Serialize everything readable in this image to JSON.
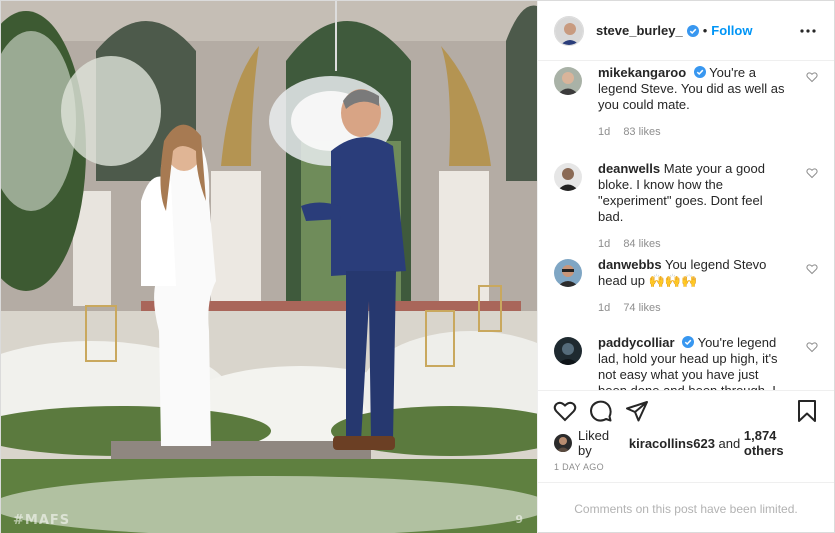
{
  "header": {
    "username": "steve_burley_",
    "dot": "•",
    "follow_label": "Follow"
  },
  "comments": [
    {
      "username": "mikekangaroo",
      "text": "You're a legend Steve. You did as well as you could mate.",
      "time": "1d",
      "likes": "83 likes",
      "verified": true
    },
    {
      "username": "deanwells",
      "text": "Mate your a good bloke. I know how the \"experiment\" goes. Dont feel bad.",
      "time": "1d",
      "likes": "84 likes",
      "verified": false
    },
    {
      "username": "danwebbs",
      "text": "You legend Stevo head up 🙌🙌🙌",
      "time": "1d",
      "likes": "74 likes",
      "verified": false
    },
    {
      "username": "paddycolliar",
      "text": "You're legend lad, hold your head up high, it's not easy what you have just been done and been through. I met them ah...",
      "time": "",
      "likes": "",
      "verified": true
    }
  ],
  "liked_by": {
    "prefix": "Liked by",
    "user": "kiracollins623",
    "middle": "and",
    "count": "1,874 others"
  },
  "timestamp": "1 DAY AGO",
  "comments_limited": "Comments on this post have been limited.",
  "watermarks": {
    "left": "#MAFS",
    "right": "9"
  },
  "icons": {
    "verified": "verified-badge-icon",
    "more": "more-options-icon",
    "like": "heart-icon",
    "comment": "comment-bubble-icon",
    "share": "paper-plane-icon",
    "save": "bookmark-icon"
  },
  "colors": {
    "accent": "#0095f6",
    "muted": "#8e8e8e",
    "border": "#efefef"
  }
}
